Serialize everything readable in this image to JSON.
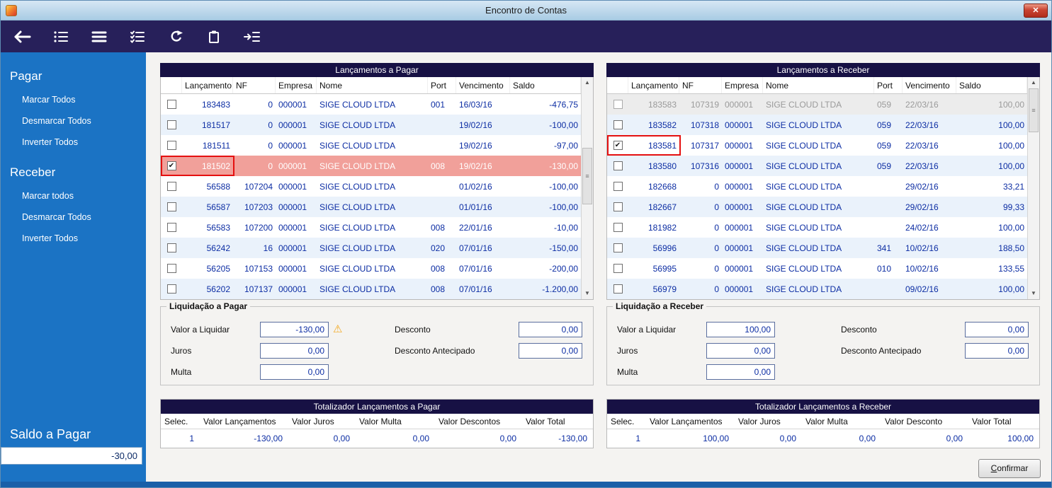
{
  "glyphs": {
    "close": "✕",
    "check": "✔",
    "scroll_up": "▲",
    "scroll_down": "▼",
    "thumb_grip": "≡",
    "warning": "⚠"
  },
  "colors": {
    "titlebar": "#b9d7ea",
    "toolbar_bg": "#27205a",
    "sidebar_bg": "#1b73c4",
    "panel_header_bg": "#171144",
    "row_alt": "#eaf2fb",
    "row_selected": "#f1a09a",
    "row_disabled_bg": "#ececec",
    "value_text": "#0c2da3",
    "annotation_red": "#e51010",
    "warning_yellow": "#f2a71b"
  },
  "window": {
    "title": "Encontro de Contas"
  },
  "toolbar": {
    "icons": [
      "back-icon",
      "detail-list-icon",
      "menu-lines-icon",
      "checklist-icon",
      "refresh-icon",
      "paste-icon",
      "export-list-icon"
    ]
  },
  "sidebar": {
    "sections": [
      {
        "heading": "Pagar",
        "items": [
          "Marcar Todos",
          "Desmarcar Todos",
          "Inverter Todos"
        ]
      },
      {
        "heading": "Receber",
        "items": [
          "Marcar todos",
          "Desmarcar Todos",
          "Inverter Todos"
        ]
      }
    ],
    "saldo_label": "Saldo a Pagar",
    "saldo_value": "-30,00"
  },
  "pagar_grid": {
    "title": "Lançamentos a Pagar",
    "columns": [
      "Lançamento",
      "NF",
      "Empresa",
      "Nome",
      "Port",
      "Vencimento",
      "Saldo"
    ],
    "rows": [
      {
        "checked": false,
        "values": [
          "183483",
          "0",
          "000001",
          "SIGE CLOUD LTDA",
          "001",
          "16/03/16",
          "-476,75"
        ]
      },
      {
        "checked": false,
        "values": [
          "181517",
          "0",
          "000001",
          "SIGE CLOUD LTDA",
          "",
          "19/02/16",
          "-100,00"
        ]
      },
      {
        "checked": false,
        "values": [
          "181511",
          "0",
          "000001",
          "SIGE CLOUD LTDA",
          "",
          "19/02/16",
          "-97,00"
        ]
      },
      {
        "checked": true,
        "state": "selected",
        "annotated": true,
        "values": [
          "181502",
          "0",
          "000001",
          "SIGE CLOUD LTDA",
          "008",
          "19/02/16",
          "-130,00"
        ]
      },
      {
        "checked": false,
        "values": [
          "56588",
          "107204",
          "000001",
          "SIGE CLOUD LTDA",
          "",
          "01/02/16",
          "-100,00"
        ]
      },
      {
        "checked": false,
        "values": [
          "56587",
          "107203",
          "000001",
          "SIGE CLOUD LTDA",
          "",
          "01/01/16",
          "-100,00"
        ]
      },
      {
        "checked": false,
        "values": [
          "56583",
          "107200",
          "000001",
          "SIGE CLOUD LTDA",
          "008",
          "22/01/16",
          "-10,00"
        ]
      },
      {
        "checked": false,
        "values": [
          "56242",
          "16",
          "000001",
          "SIGE CLOUD LTDA",
          "020",
          "07/01/16",
          "-150,00"
        ]
      },
      {
        "checked": false,
        "values": [
          "56205",
          "107153",
          "000001",
          "SIGE CLOUD LTDA",
          "008",
          "07/01/16",
          "-200,00"
        ]
      },
      {
        "checked": false,
        "values": [
          "56202",
          "107137",
          "000001",
          "SIGE CLOUD LTDA",
          "008",
          "07/01/16",
          "-1.200,00"
        ]
      }
    ]
  },
  "receber_grid": {
    "title": "Lançamentos a Receber",
    "columns": [
      "Lançamento",
      "NF",
      "Empresa",
      "Nome",
      "Port",
      "Vencimento",
      "Saldo"
    ],
    "rows": [
      {
        "checked": false,
        "state": "disabled",
        "values": [
          "183583",
          "107319",
          "000001",
          "SIGE CLOUD LTDA",
          "059",
          "22/03/16",
          "100,00"
        ]
      },
      {
        "checked": false,
        "values": [
          "183582",
          "107318",
          "000001",
          "SIGE CLOUD LTDA",
          "059",
          "22/03/16",
          "100,00"
        ]
      },
      {
        "checked": true,
        "annotated": true,
        "values": [
          "183581",
          "107317",
          "000001",
          "SIGE CLOUD LTDA",
          "059",
          "22/03/16",
          "100,00"
        ]
      },
      {
        "checked": false,
        "values": [
          "183580",
          "107316",
          "000001",
          "SIGE CLOUD LTDA",
          "059",
          "22/03/16",
          "100,00"
        ]
      },
      {
        "checked": false,
        "values": [
          "182668",
          "0",
          "000001",
          "SIGE CLOUD LTDA",
          "",
          "29/02/16",
          "33,21"
        ]
      },
      {
        "checked": false,
        "values": [
          "182667",
          "0",
          "000001",
          "SIGE CLOUD LTDA",
          "",
          "29/02/16",
          "99,33"
        ]
      },
      {
        "checked": false,
        "values": [
          "181982",
          "0",
          "000001",
          "SIGE CLOUD LTDA",
          "",
          "24/02/16",
          "100,00"
        ]
      },
      {
        "checked": false,
        "values": [
          "56996",
          "0",
          "000001",
          "SIGE CLOUD LTDA",
          "341",
          "10/02/16",
          "188,50"
        ]
      },
      {
        "checked": false,
        "values": [
          "56995",
          "0",
          "000001",
          "SIGE CLOUD LTDA",
          "010",
          "10/02/16",
          "133,55"
        ]
      },
      {
        "checked": false,
        "values": [
          "56979",
          "0",
          "000001",
          "SIGE CLOUD LTDA",
          "",
          "09/02/16",
          "100,00"
        ]
      }
    ]
  },
  "liquidacao_pagar": {
    "title": "Liquidação a Pagar",
    "valor_label": "Valor a Liquidar",
    "valor": "-130,00",
    "juros_label": "Juros",
    "juros": "0,00",
    "multa_label": "Multa",
    "multa": "0,00",
    "desconto_label": "Desconto",
    "desconto": "0,00",
    "desc_ant_label": "Desconto Antecipado",
    "desc_ant": "0,00"
  },
  "liquidacao_receber": {
    "title": "Liquidação a Receber",
    "valor_label": "Valor a Liquidar",
    "valor": "100,00",
    "juros_label": "Juros",
    "juros": "0,00",
    "multa_label": "Multa",
    "multa": "0,00",
    "desconto_label": "Desconto",
    "desconto": "0,00",
    "desc_ant_label": "Desconto Antecipado",
    "desc_ant": "0,00"
  },
  "totalizador_pagar": {
    "title": "Totalizador Lançamentos a Pagar",
    "columns": [
      "Selec.",
      "Valor Lançamentos",
      "Valor Juros",
      "Valor Multa",
      "Valor Descontos",
      "Valor Total"
    ],
    "row": [
      "1",
      "-130,00",
      "0,00",
      "0,00",
      "0,00",
      "-130,00"
    ]
  },
  "totalizador_receber": {
    "title": "Totalizador Lançamentos a Receber",
    "columns": [
      "Selec.",
      "Valor Lançamentos",
      "Valor Juros",
      "Valor Multa",
      "Valor Desconto",
      "Valor Total"
    ],
    "row": [
      "1",
      "100,00",
      "0,00",
      "0,00",
      "0,00",
      "100,00"
    ]
  },
  "confirm": {
    "label": "Confirmar"
  }
}
